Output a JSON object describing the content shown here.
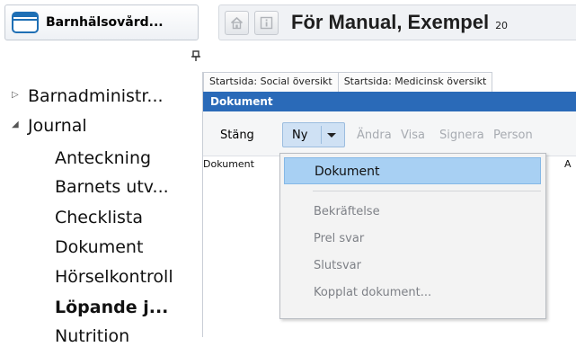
{
  "app": {
    "title": "Barnhälsovård...",
    "icon": "folder-icon"
  },
  "header": {
    "home_icon": "home-icon",
    "info_icon": "info-icon",
    "patient_name": "För Manual, Exempel",
    "patient_extra": "20"
  },
  "nav": {
    "pin_icon": "pin-icon",
    "items": [
      {
        "label": "Barnadministr...",
        "expander": "collapsed"
      },
      {
        "label": "Journal",
        "expander": "expanded"
      }
    ],
    "sub_items": [
      {
        "label": "Anteckning"
      },
      {
        "label": "Barnets utv..."
      },
      {
        "label": "Checklista"
      },
      {
        "label": "Dokument"
      },
      {
        "label": "Hörselkontroll"
      },
      {
        "label": "Löpande j...",
        "active": true
      },
      {
        "label": "Nutrition"
      }
    ]
  },
  "tabs": [
    {
      "label": "Startsida: Social översikt"
    },
    {
      "label": "Startsida: Medicinsk översikt"
    }
  ],
  "panel": {
    "title": "Dokument"
  },
  "toolbar": {
    "close": "Stäng",
    "new": "Ny",
    "edit": "Ändra",
    "view": "Visa",
    "sign": "Signera",
    "person": "Person"
  },
  "list": {
    "col1": "Dokument",
    "col2": "A"
  },
  "menu": {
    "items": [
      {
        "label": "Dokument",
        "highlighted": true
      },
      {
        "label": "Bekräftelse"
      },
      {
        "label": "Prel svar"
      },
      {
        "label": "Slutsvar"
      },
      {
        "label": "Kopplat dokument..."
      }
    ]
  },
  "colors": {
    "accent": "#2a6ab8",
    "highlight": "#a8d0f3",
    "disabled": "#a7abb1"
  }
}
